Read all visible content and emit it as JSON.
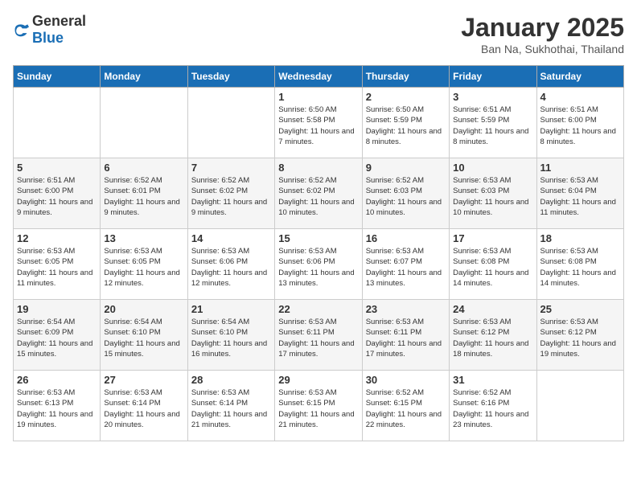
{
  "logo": {
    "text_general": "General",
    "text_blue": "Blue"
  },
  "header": {
    "title": "January 2025",
    "location": "Ban Na, Sukhothai, Thailand"
  },
  "weekdays": [
    "Sunday",
    "Monday",
    "Tuesday",
    "Wednesday",
    "Thursday",
    "Friday",
    "Saturday"
  ],
  "weeks": [
    [
      {
        "day": "",
        "sunrise": "",
        "sunset": "",
        "daylight": ""
      },
      {
        "day": "",
        "sunrise": "",
        "sunset": "",
        "daylight": ""
      },
      {
        "day": "",
        "sunrise": "",
        "sunset": "",
        "daylight": ""
      },
      {
        "day": "1",
        "sunrise": "Sunrise: 6:50 AM",
        "sunset": "Sunset: 5:58 PM",
        "daylight": "Daylight: 11 hours and 7 minutes."
      },
      {
        "day": "2",
        "sunrise": "Sunrise: 6:50 AM",
        "sunset": "Sunset: 5:59 PM",
        "daylight": "Daylight: 11 hours and 8 minutes."
      },
      {
        "day": "3",
        "sunrise": "Sunrise: 6:51 AM",
        "sunset": "Sunset: 5:59 PM",
        "daylight": "Daylight: 11 hours and 8 minutes."
      },
      {
        "day": "4",
        "sunrise": "Sunrise: 6:51 AM",
        "sunset": "Sunset: 6:00 PM",
        "daylight": "Daylight: 11 hours and 8 minutes."
      }
    ],
    [
      {
        "day": "5",
        "sunrise": "Sunrise: 6:51 AM",
        "sunset": "Sunset: 6:00 PM",
        "daylight": "Daylight: 11 hours and 9 minutes."
      },
      {
        "day": "6",
        "sunrise": "Sunrise: 6:52 AM",
        "sunset": "Sunset: 6:01 PM",
        "daylight": "Daylight: 11 hours and 9 minutes."
      },
      {
        "day": "7",
        "sunrise": "Sunrise: 6:52 AM",
        "sunset": "Sunset: 6:02 PM",
        "daylight": "Daylight: 11 hours and 9 minutes."
      },
      {
        "day": "8",
        "sunrise": "Sunrise: 6:52 AM",
        "sunset": "Sunset: 6:02 PM",
        "daylight": "Daylight: 11 hours and 10 minutes."
      },
      {
        "day": "9",
        "sunrise": "Sunrise: 6:52 AM",
        "sunset": "Sunset: 6:03 PM",
        "daylight": "Daylight: 11 hours and 10 minutes."
      },
      {
        "day": "10",
        "sunrise": "Sunrise: 6:53 AM",
        "sunset": "Sunset: 6:03 PM",
        "daylight": "Daylight: 11 hours and 10 minutes."
      },
      {
        "day": "11",
        "sunrise": "Sunrise: 6:53 AM",
        "sunset": "Sunset: 6:04 PM",
        "daylight": "Daylight: 11 hours and 11 minutes."
      }
    ],
    [
      {
        "day": "12",
        "sunrise": "Sunrise: 6:53 AM",
        "sunset": "Sunset: 6:05 PM",
        "daylight": "Daylight: 11 hours and 11 minutes."
      },
      {
        "day": "13",
        "sunrise": "Sunrise: 6:53 AM",
        "sunset": "Sunset: 6:05 PM",
        "daylight": "Daylight: 11 hours and 12 minutes."
      },
      {
        "day": "14",
        "sunrise": "Sunrise: 6:53 AM",
        "sunset": "Sunset: 6:06 PM",
        "daylight": "Daylight: 11 hours and 12 minutes."
      },
      {
        "day": "15",
        "sunrise": "Sunrise: 6:53 AM",
        "sunset": "Sunset: 6:06 PM",
        "daylight": "Daylight: 11 hours and 13 minutes."
      },
      {
        "day": "16",
        "sunrise": "Sunrise: 6:53 AM",
        "sunset": "Sunset: 6:07 PM",
        "daylight": "Daylight: 11 hours and 13 minutes."
      },
      {
        "day": "17",
        "sunrise": "Sunrise: 6:53 AM",
        "sunset": "Sunset: 6:08 PM",
        "daylight": "Daylight: 11 hours and 14 minutes."
      },
      {
        "day": "18",
        "sunrise": "Sunrise: 6:53 AM",
        "sunset": "Sunset: 6:08 PM",
        "daylight": "Daylight: 11 hours and 14 minutes."
      }
    ],
    [
      {
        "day": "19",
        "sunrise": "Sunrise: 6:54 AM",
        "sunset": "Sunset: 6:09 PM",
        "daylight": "Daylight: 11 hours and 15 minutes."
      },
      {
        "day": "20",
        "sunrise": "Sunrise: 6:54 AM",
        "sunset": "Sunset: 6:10 PM",
        "daylight": "Daylight: 11 hours and 15 minutes."
      },
      {
        "day": "21",
        "sunrise": "Sunrise: 6:54 AM",
        "sunset": "Sunset: 6:10 PM",
        "daylight": "Daylight: 11 hours and 16 minutes."
      },
      {
        "day": "22",
        "sunrise": "Sunrise: 6:53 AM",
        "sunset": "Sunset: 6:11 PM",
        "daylight": "Daylight: 11 hours and 17 minutes."
      },
      {
        "day": "23",
        "sunrise": "Sunrise: 6:53 AM",
        "sunset": "Sunset: 6:11 PM",
        "daylight": "Daylight: 11 hours and 17 minutes."
      },
      {
        "day": "24",
        "sunrise": "Sunrise: 6:53 AM",
        "sunset": "Sunset: 6:12 PM",
        "daylight": "Daylight: 11 hours and 18 minutes."
      },
      {
        "day": "25",
        "sunrise": "Sunrise: 6:53 AM",
        "sunset": "Sunset: 6:12 PM",
        "daylight": "Daylight: 11 hours and 19 minutes."
      }
    ],
    [
      {
        "day": "26",
        "sunrise": "Sunrise: 6:53 AM",
        "sunset": "Sunset: 6:13 PM",
        "daylight": "Daylight: 11 hours and 19 minutes."
      },
      {
        "day": "27",
        "sunrise": "Sunrise: 6:53 AM",
        "sunset": "Sunset: 6:14 PM",
        "daylight": "Daylight: 11 hours and 20 minutes."
      },
      {
        "day": "28",
        "sunrise": "Sunrise: 6:53 AM",
        "sunset": "Sunset: 6:14 PM",
        "daylight": "Daylight: 11 hours and 21 minutes."
      },
      {
        "day": "29",
        "sunrise": "Sunrise: 6:53 AM",
        "sunset": "Sunset: 6:15 PM",
        "daylight": "Daylight: 11 hours and 21 minutes."
      },
      {
        "day": "30",
        "sunrise": "Sunrise: 6:52 AM",
        "sunset": "Sunset: 6:15 PM",
        "daylight": "Daylight: 11 hours and 22 minutes."
      },
      {
        "day": "31",
        "sunrise": "Sunrise: 6:52 AM",
        "sunset": "Sunset: 6:16 PM",
        "daylight": "Daylight: 11 hours and 23 minutes."
      },
      {
        "day": "",
        "sunrise": "",
        "sunset": "",
        "daylight": ""
      }
    ]
  ]
}
